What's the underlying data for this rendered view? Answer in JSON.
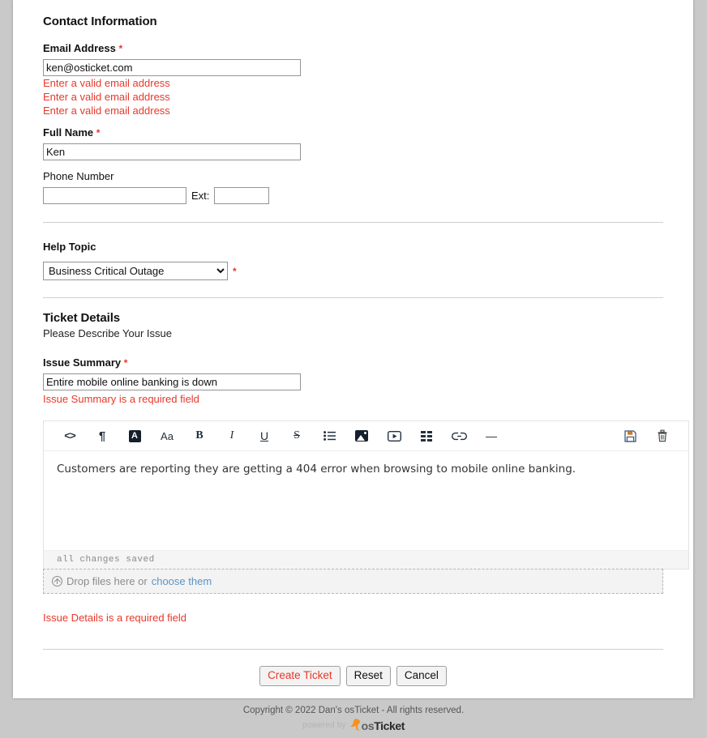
{
  "contact": {
    "section_title": "Contact Information",
    "email": {
      "label": "Email Address",
      "required_mark": "*",
      "value": "ken@osticket.com",
      "placeholder": "",
      "errors": [
        "Enter a valid email address",
        "Enter a valid email address",
        "Enter a valid email address"
      ]
    },
    "full_name": {
      "label": "Full Name",
      "required_mark": "*",
      "value": "Ken",
      "placeholder": ""
    },
    "phone": {
      "label": "Phone Number",
      "value": "",
      "placeholder": "",
      "ext_label": "Ext:",
      "ext_value": "",
      "ext_placeholder": ""
    }
  },
  "help_topic": {
    "label": "Help Topic",
    "required_mark": "*",
    "selected": "Business Critical Outage",
    "options": [
      "Business Critical Outage"
    ]
  },
  "ticket_details": {
    "section_title": "Ticket Details",
    "subtitle": "Please Describe Your Issue",
    "issue_summary": {
      "label": "Issue Summary",
      "required_mark": "*",
      "value": "Entire mobile online banking is down",
      "placeholder": "",
      "error": "Issue Summary is a required field"
    },
    "editor": {
      "toolbar_left": [
        {
          "name": "source-code-icon",
          "glyph": "<>"
        },
        {
          "name": "paragraph-format-icon",
          "glyph": "¶"
        },
        {
          "name": "text-color-icon",
          "glyph": "A"
        },
        {
          "name": "font-size-icon",
          "glyph": "Aa"
        },
        {
          "name": "bold-icon",
          "glyph": "B"
        },
        {
          "name": "italic-icon",
          "glyph": "I"
        },
        {
          "name": "underline-icon",
          "glyph": "U"
        },
        {
          "name": "strikethrough-icon",
          "glyph": "S"
        },
        {
          "name": "bullet-list-icon",
          "glyph": "list"
        },
        {
          "name": "insert-image-icon",
          "glyph": "image"
        },
        {
          "name": "insert-video-icon",
          "glyph": "video"
        },
        {
          "name": "insert-table-icon",
          "glyph": "table"
        },
        {
          "name": "insert-link-icon",
          "glyph": "link"
        },
        {
          "name": "horizontal-rule-icon",
          "glyph": "—"
        }
      ],
      "toolbar_right": [
        {
          "name": "save-draft-icon",
          "glyph": "save"
        },
        {
          "name": "delete-draft-icon",
          "glyph": "trash"
        }
      ],
      "body_text": "Customers are reporting they are getting a 404 error when browsing to mobile online banking.",
      "status_text": "all changes saved"
    },
    "dropzone": {
      "icon": "upload-circle-icon",
      "text": "Drop files here or",
      "link_text": "choose them"
    },
    "details_error": "Issue Details is a required field"
  },
  "actions": {
    "submit": "Create Ticket",
    "reset": "Reset",
    "cancel": "Cancel",
    "submit_color": "#e8382a"
  },
  "footer": {
    "copyright": "Copyright © 2022 Dan's osTicket - All rights reserved.",
    "powered_by": "powered by",
    "brand_prefix": "os",
    "brand_suffix": "Ticket",
    "brand_color": "#f5911e"
  }
}
